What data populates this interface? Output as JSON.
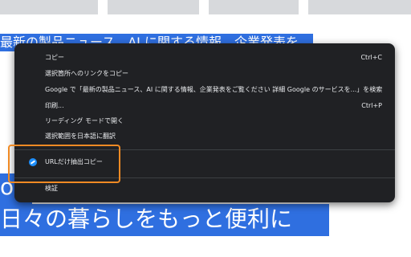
{
  "page": {
    "selected_heading": "最新の製品ニュース、AI に関する情報、企業発表を",
    "selected_fragment": "og",
    "selected_tagline": "日々の暮らしをもっと便利に"
  },
  "context_menu": {
    "items": [
      {
        "label": "コピー",
        "shortcut": "Ctrl+C"
      },
      {
        "label": "選択箇所へのリンクをコピー",
        "shortcut": ""
      },
      {
        "label": "Google で「最新の製品ニュース、AI に関する情報、企業発表をご覧ください 詳細 Google のサービスを...」を検索",
        "shortcut": ""
      },
      {
        "label": "印刷...",
        "shortcut": "Ctrl+P"
      },
      {
        "label": "リーディング モードで開く",
        "shortcut": ""
      },
      {
        "label": "選択範囲を日本語に翻訳",
        "shortcut": ""
      },
      {
        "label": "URLだけ抽出コピー",
        "icon": "extension-icon"
      },
      {
        "label": "検証",
        "shortcut": ""
      }
    ]
  },
  "colors": {
    "menu_background": "#202124",
    "selection": "#2f6fe0",
    "highlight_border": "#f08a24"
  }
}
